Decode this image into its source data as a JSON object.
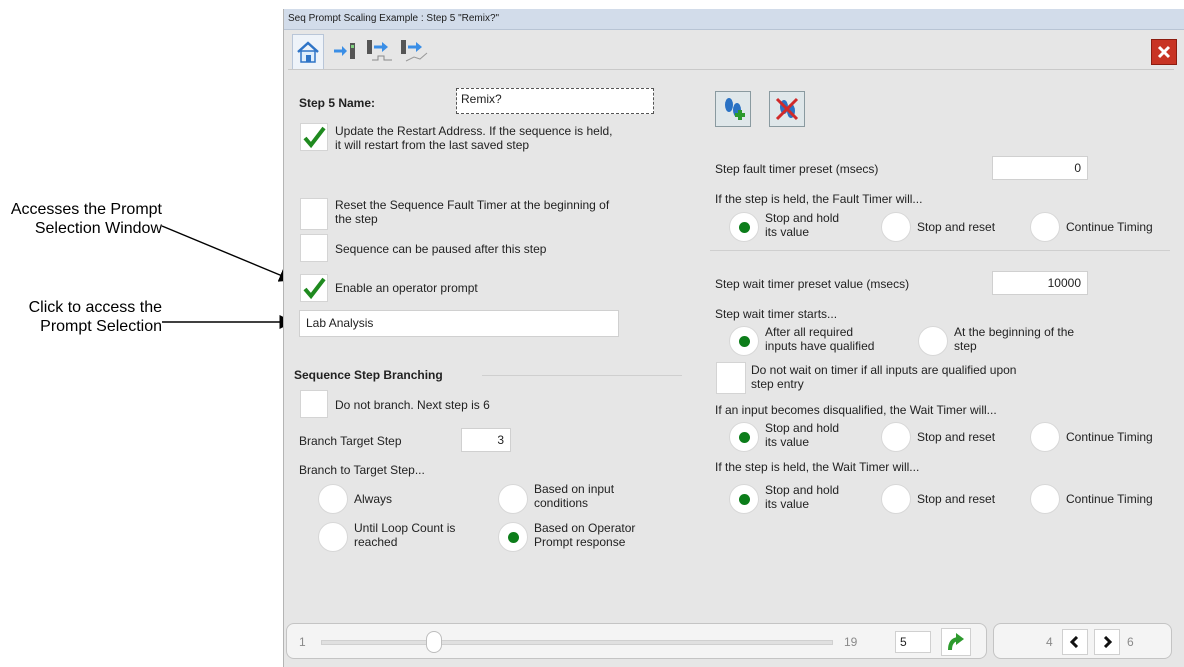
{
  "callouts": {
    "prompt_window": "Accesses the Prompt\nSelection Window",
    "prompt_selection": "Click to access the\nPrompt Selection"
  },
  "window": {
    "title": "Seq Prompt Scaling Example : Step 5 \"Remix?\""
  },
  "step": {
    "name_label": "Step 5 Name:",
    "name_value": "Remix?",
    "update_restart_label": "Update the Restart Address.  If the sequence is held,\nit will restart from the last saved step",
    "update_restart_checked": true,
    "reset_fault_label": "Reset the Sequence Fault Timer at the beginning of\nthe step",
    "reset_fault_checked": false,
    "pause_label": "Sequence can be paused after this step",
    "pause_checked": false,
    "enable_prompt_label": "Enable an operator prompt",
    "enable_prompt_checked": true,
    "prompt_value": "Lab Analysis"
  },
  "branching": {
    "heading": "Sequence Step Branching",
    "no_branch_label": "Do not branch.  Next step is 6",
    "no_branch_checked": false,
    "target_label": "Branch Target Step",
    "target_value": "3",
    "to_target_label": "Branch to Target Step...",
    "options": {
      "always": "Always",
      "input": "Based on input\nconditions",
      "loop": "Until Loop Count is\nreached",
      "operator": "Based on Operator\nPrompt response"
    },
    "selected": "operator"
  },
  "fault": {
    "preset_label": "Step fault timer preset (msecs)",
    "preset_value": "0",
    "held_label": "If the step is held, the Fault Timer will...",
    "options": {
      "stop_hold": "Stop and hold\nits value",
      "stop_reset": "Stop and reset",
      "continue": "Continue Timing"
    },
    "selected": "stop_hold"
  },
  "wait": {
    "preset_label": "Step wait timer preset value (msecs)",
    "preset_value": "10000",
    "starts_label": "Step wait timer starts...",
    "start_opts": {
      "after": "After all required\ninputs have qualified",
      "beginning": "At the beginning of the\nstep"
    },
    "start_selected": "after",
    "no_wait_label": "Do not wait on timer if all inputs are qualified upon\nstep entry",
    "no_wait_checked": false,
    "disq_label": "If an input becomes disqualified, the Wait Timer will...",
    "disq_options": {
      "stop_hold": "Stop and hold\nits value",
      "stop_reset": "Stop and reset",
      "continue": "Continue Timing"
    },
    "disq_selected": "stop_hold",
    "held_label": "If the step is held, the Wait Timer will...",
    "held_options": {
      "stop_hold": "Stop and hold\nits value",
      "stop_reset": "Stop and reset",
      "continue": "Continue Timing"
    },
    "held_selected": "stop_hold"
  },
  "nav": {
    "slider_min": "1",
    "slider_max": "19",
    "slider_value": 5,
    "step_value": "5",
    "page_left": "4",
    "page_right": "6"
  },
  "colors": {
    "selected_radio": "#0c7d1a",
    "check": "#1f8a1f",
    "close": "#c83424"
  }
}
